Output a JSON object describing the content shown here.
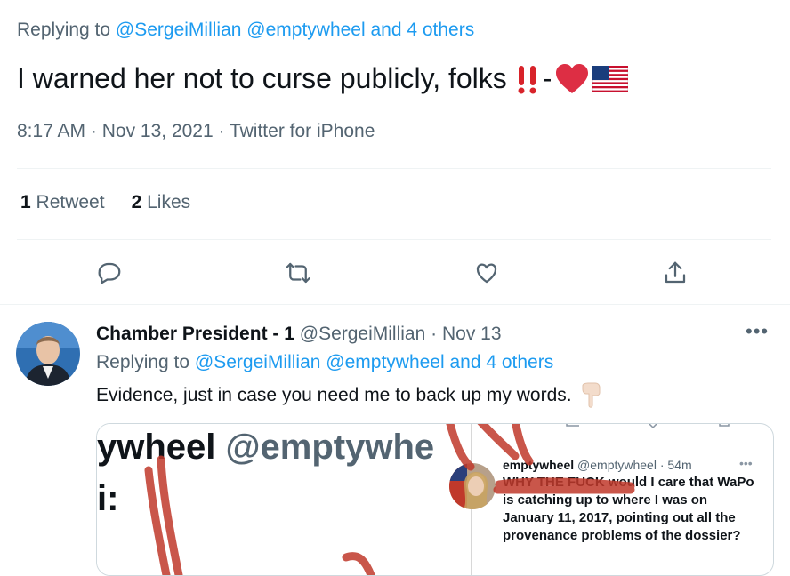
{
  "main_tweet": {
    "replying_prefix": "Replying to",
    "replying_to": "@SergeiMillian @emptywheel and 4 others",
    "text": "I warned her not to curse publicly, folks",
    "time": "8:17 AM",
    "date": "Nov 13, 2021",
    "client": "Twitter for iPhone",
    "retweets_count": "1",
    "retweets_label": "Retweet",
    "likes_count": "2",
    "likes_label": "Likes"
  },
  "actions": [
    "reply-icon",
    "retweet-icon",
    "like-icon",
    "share-icon"
  ],
  "reply": {
    "name": "Chamber President - 1",
    "handle": "@SergeiMillian",
    "date": "Nov 13",
    "more": "•••",
    "replying_prefix": "Replying to",
    "replying_to": "@SergeiMillian @emptywheel and 4 others",
    "text": "Evidence, just in case you need me to back up my words.",
    "media": {
      "big_line1_name": "ywheel",
      "big_line1_handle": "@emptywhe",
      "big_line2": "i:",
      "inner_name": "emptywheel",
      "inner_handle": "@emptywheel",
      "inner_time": "54m",
      "inner_text": "WHY THE FUCK would I care that WaPo is catching up to where I was on January 11, 2017, pointing out all the provenance problems of the dossier?"
    }
  },
  "colors": {
    "accent": "#1d9bf0",
    "muted": "#536471",
    "heart": "#e0245e",
    "scribble": "#c0392b"
  }
}
